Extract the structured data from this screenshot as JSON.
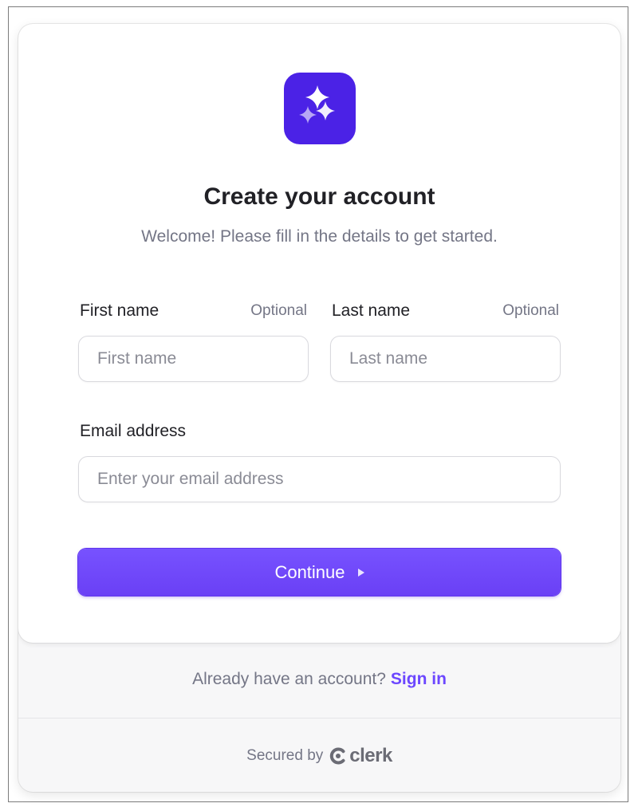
{
  "app": {
    "logo_icon": "sparkles-icon",
    "brand_color": "#4b22e6",
    "accent_color": "#6c47ff"
  },
  "header": {
    "title": "Create your account",
    "subtitle": "Welcome! Please fill in the details to get started."
  },
  "form": {
    "first_name": {
      "label": "First name",
      "optional": "Optional",
      "placeholder": "First name",
      "value": ""
    },
    "last_name": {
      "label": "Last name",
      "optional": "Optional",
      "placeholder": "Last name",
      "value": ""
    },
    "email": {
      "label": "Email address",
      "placeholder": "Enter your email address",
      "value": ""
    },
    "continue_label": "Continue",
    "continue_icon": "triangle-right-icon"
  },
  "footer": {
    "signin_prompt": "Already have an account?",
    "signin_link": "Sign in",
    "secured_by": "Secured by",
    "brand_name": "clerk",
    "brand_icon": "clerk-logo-icon"
  }
}
